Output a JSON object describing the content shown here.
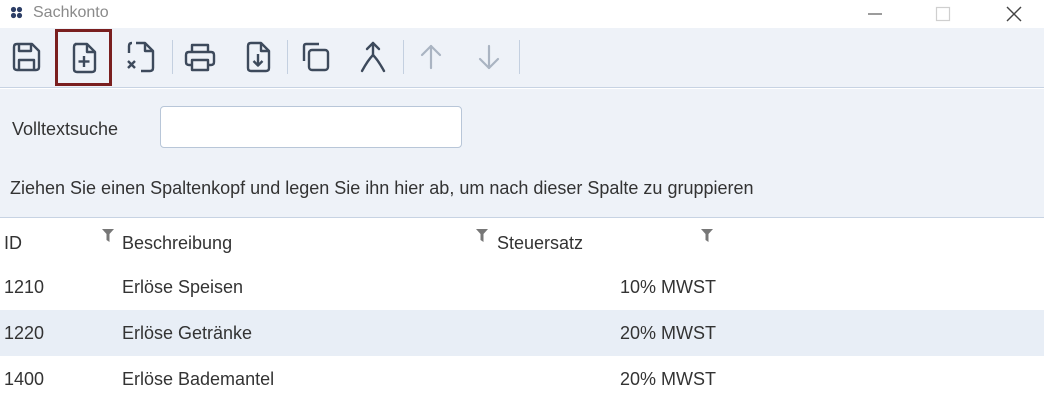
{
  "window": {
    "title": "Sachkonto",
    "icons": [
      "app-icon",
      "minimize-icon",
      "maximize-icon",
      "close-icon"
    ]
  },
  "toolbar": {
    "buttons": [
      {
        "name": "save-button",
        "icon": "save-icon",
        "enabled": true
      },
      {
        "name": "new-button",
        "icon": "new-document-icon",
        "enabled": true,
        "selected": true
      },
      {
        "name": "delete-button",
        "icon": "delete-document-icon",
        "enabled": true
      },
      {
        "name": "print-button",
        "icon": "printer-icon",
        "enabled": true
      },
      {
        "name": "export-button",
        "icon": "download-document-icon",
        "enabled": true
      },
      {
        "name": "copy-button",
        "icon": "copy-icon",
        "enabled": true
      },
      {
        "name": "merge-button",
        "icon": "merge-icon",
        "enabled": true
      },
      {
        "name": "move-up-button",
        "icon": "arrow-up-icon",
        "enabled": false
      },
      {
        "name": "move-down-button",
        "icon": "arrow-down-icon",
        "enabled": false
      }
    ],
    "selected_highlight_color": "#7a1f1f"
  },
  "search": {
    "label": "Volltextsuche",
    "value": "",
    "placeholder": ""
  },
  "grouping": {
    "hint": "Ziehen Sie einen Spaltenkopf und legen Sie ihn hier ab, um nach dieser Spalte zu gruppieren"
  },
  "grid": {
    "columns": [
      {
        "key": "id",
        "label": "ID"
      },
      {
        "key": "desc",
        "label": "Beschreibung"
      },
      {
        "key": "tax",
        "label": "Steuersatz"
      }
    ],
    "rows": [
      {
        "id": "1210",
        "desc": "Erlöse Speisen",
        "tax": "10% MWST"
      },
      {
        "id": "1220",
        "desc": "Erlöse Getränke",
        "tax": "20% MWST"
      },
      {
        "id": "1400",
        "desc": "Erlöse Bademantel",
        "tax": "20% MWST"
      }
    ],
    "alt_row_color": "#e8eef6"
  },
  "colors": {
    "toolbar_bg": "#eef2f8",
    "icon_color": "#3d4a5c",
    "disabled_icon_color": "#aab4c2"
  }
}
